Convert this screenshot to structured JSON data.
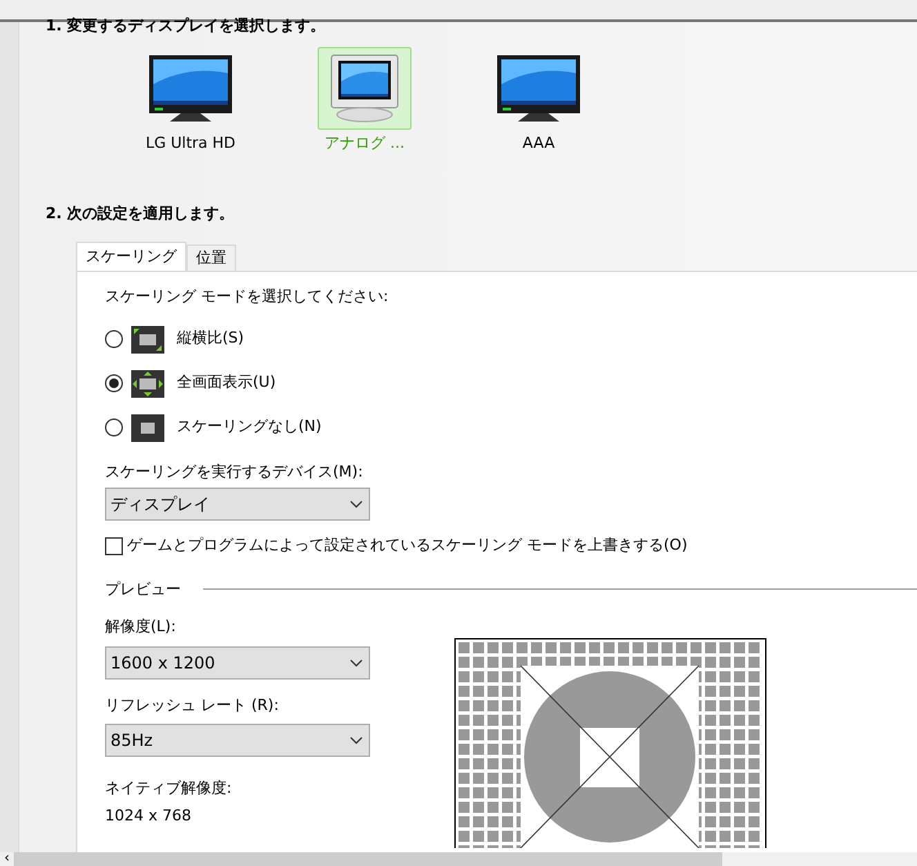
{
  "step1": {
    "title": "1. 変更するディスプレイを選択します。"
  },
  "displays": [
    {
      "name": "LG Ultra HD",
      "kind": "flat",
      "selected": false
    },
    {
      "name": "アナログ ...",
      "kind": "crt",
      "selected": true
    },
    {
      "name": "AAA",
      "kind": "flat",
      "selected": false
    }
  ],
  "step2": {
    "title": "2. 次の設定を適用します。"
  },
  "tabs": [
    {
      "label": "スケーリング",
      "selected": true
    },
    {
      "label": "位置",
      "selected": false
    }
  ],
  "scaling_mode": {
    "label": "スケーリング モードを選択してください:",
    "options": [
      {
        "label": "縦横比(S)",
        "kind": "aspect",
        "selected": false
      },
      {
        "label": "全画面表示(U)",
        "kind": "full",
        "selected": true
      },
      {
        "label": "スケーリングなし(N)",
        "kind": "none",
        "selected": false
      }
    ]
  },
  "device": {
    "label": "スケーリングを実行するデバイス(M):",
    "value": "ディスプレイ"
  },
  "override": {
    "label": "ゲームとプログラムによって設定されているスケーリング モードを上書きする(O)",
    "checked": false
  },
  "preview": {
    "title": "プレビュー",
    "resolution": {
      "label": "解像度(L):",
      "value": "1600 x 1200"
    },
    "refresh": {
      "label": "リフレッシュ レート (R):",
      "value": "85Hz"
    },
    "native": {
      "label": "ネイティブ解像度:",
      "value": "1024 x 768"
    }
  },
  "scrollbar": {
    "left_arrow": "‹"
  }
}
